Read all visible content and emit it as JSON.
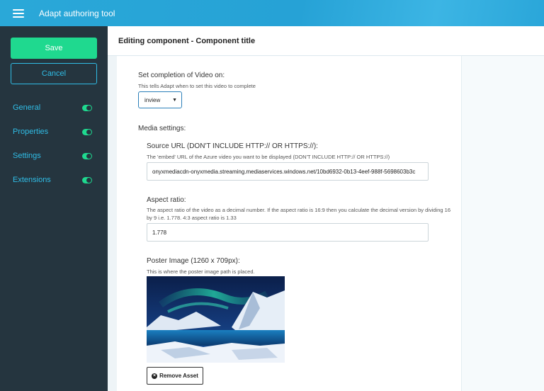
{
  "app": {
    "title": "Adapt authoring tool"
  },
  "sidebar": {
    "save_label": "Save",
    "cancel_label": "Cancel",
    "items": [
      {
        "label": "General",
        "enabled": true
      },
      {
        "label": "Properties",
        "enabled": true
      },
      {
        "label": "Settings",
        "enabled": true
      },
      {
        "label": "Extensions",
        "enabled": true
      }
    ]
  },
  "header": {
    "title": "Editing component - Component title"
  },
  "form": {
    "completion": {
      "label": "Set completion of Video on:",
      "help": "This tells Adapt when to set this video to complete",
      "value": "inview"
    },
    "media_settings_label": "Media settings:",
    "source_url": {
      "label": "Source URL (DON'T INCLUDE HTTP:// OR HTTPS://):",
      "help": "The 'embed' URL of the Azure video you want to be displayed (DON'T INCLUDE HTTP:// OR HTTPS://)",
      "value": "onyxmediacdn-onyxmedia.streaming.mediaservices.windows.net/10bd6932-0b13-4eef-988f-5698603b3c"
    },
    "aspect_ratio": {
      "label": "Aspect ratio:",
      "help": "The aspect ratio of the video as a decimal number. If the aspect ratio is 16:9 then you calculate the decimal version by dividing 16 by 9 i.e. 1.778. 4:3 aspect ratio is 1.33",
      "value": "1.778"
    },
    "poster": {
      "label": "Poster Image (1260 x 709px):",
      "help": "This is where the poster image path is placed.",
      "remove_label": "Remove Asset"
    }
  },
  "colors": {
    "topbar": "#2aa8d8",
    "sidebar": "#25353f",
    "accent_green": "#1fd98f",
    "accent_blue": "#30bde6"
  }
}
